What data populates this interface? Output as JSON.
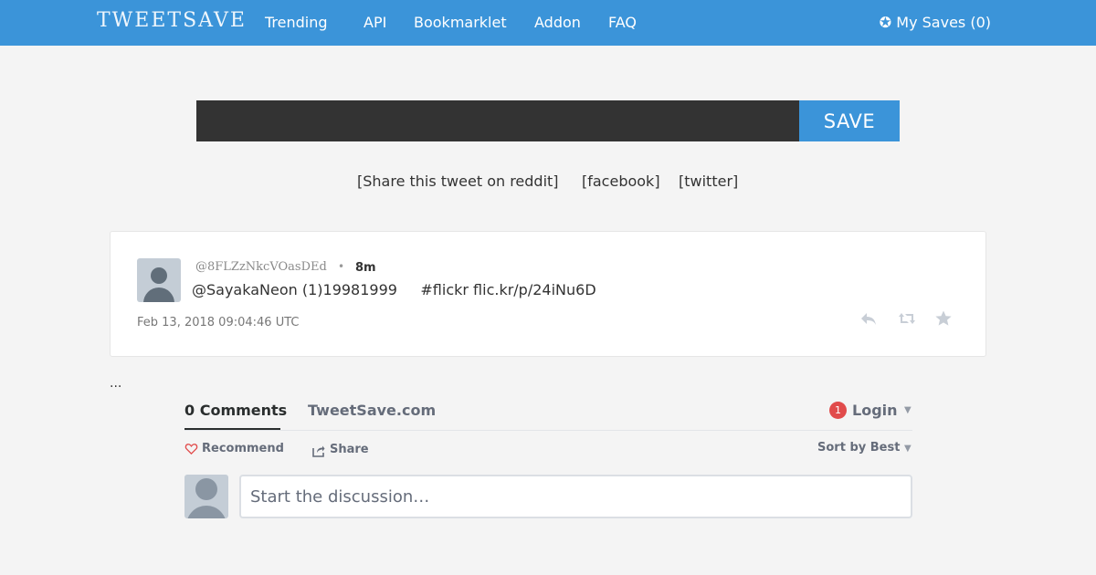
{
  "header": {
    "logo": "TWEETSAVE",
    "nav": [
      "Trending",
      "API",
      "Bookmarklet",
      "Addon",
      "FAQ"
    ],
    "my_saves": "✪ My Saves (0)"
  },
  "save_form": {
    "input_value": "",
    "button_label": "SAVE"
  },
  "share_links": [
    "[Share this tweet on reddit]",
    "[facebook]",
    "[twitter]"
  ],
  "tweet": {
    "handle": "@8FLZzNkcVOasDEd",
    "separator": "•",
    "time": "8m",
    "text": "@SayakaNeon (1)19981999     #flickr flic.kr/p/24iNu6D",
    "date": "Feb 13, 2018 09:04:46 UTC",
    "actions": [
      "reply-icon",
      "retweet-icon",
      "favorite-icon"
    ]
  },
  "ellipsis": "...",
  "comments": {
    "count_label": "0 Comments",
    "site_name": "TweetSave.com",
    "notification_count": "1",
    "login_label": "Login",
    "recommend_label": "Recommend",
    "share_label": "Share",
    "sort_label": "Sort by Best",
    "discussion_placeholder": "Start the discussion…"
  },
  "colors": {
    "brand_blue": "#3b94d9",
    "input_dark": "#333333",
    "badge_red": "#e14b4b"
  }
}
